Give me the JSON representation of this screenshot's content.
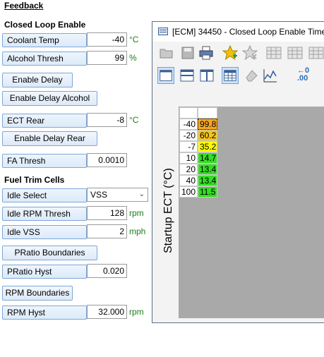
{
  "feedback_title": "Feedback",
  "closed_loop": {
    "heading": "Closed Loop Enable",
    "coolant_temp": {
      "label": "Coolant Temp",
      "value": "-40",
      "unit": "°C"
    },
    "alcohol_thresh": {
      "label": "Alcohol Thresh",
      "value": "99",
      "unit": "%"
    },
    "enable_delay_button": "Enable Delay",
    "enable_delay_alcohol_button": "Enable Delay Alcohol",
    "ect_rear": {
      "label": "ECT Rear",
      "value": "-8",
      "unit": "°C"
    },
    "enable_delay_rear_button": "Enable Delay Rear",
    "fa_thresh": {
      "label": "FA Thresh",
      "value": "0.0010"
    }
  },
  "fuel_trim": {
    "heading": "Fuel Trim Cells",
    "idle_select": {
      "label": "Idle Select",
      "value": "VSS"
    },
    "idle_rpm_thresh": {
      "label": "Idle RPM Thresh",
      "value": "128",
      "unit": "rpm"
    },
    "idle_vss": {
      "label": "Idle VSS",
      "value": "2",
      "unit": "mph"
    },
    "pratio_boundaries_button": "PRatio Boundaries",
    "pratio_hyst": {
      "label": "PRatio Hyst",
      "value": "0.020"
    },
    "rpm_boundaries_button": "RPM Boundaries",
    "rpm_hyst": {
      "label": "RPM Hyst",
      "value": "32.000",
      "unit": "rpm"
    }
  },
  "window": {
    "title": "[ECM] 34450 - Closed Loop Enable Time",
    "y_axis_label": "Startup ECT (°C)",
    "toolbar_icons": [
      "open-folder-icon",
      "save-icon",
      "print-icon",
      "add-favorite-icon",
      "remove-favorite-icon",
      "table-icon",
      "table-icon",
      "table-icon",
      "table-icon",
      "layout-single-icon",
      "layout-horizontal-split-icon",
      "layout-vertical-split-icon",
      "table-view-icon",
      "eraser-icon",
      "graph-icon",
      "decimal-places-icon"
    ],
    "decimal_icon_text": [
      "←0",
      ".00"
    ],
    "table": {
      "rows": [
        {
          "header": "-40",
          "value": "99.8",
          "color": "#f5a623",
          "selected": true
        },
        {
          "header": "-20",
          "value": "60.2",
          "color": "#f5c518"
        },
        {
          "header": "-7",
          "value": "35.2",
          "color": "#ffff00"
        },
        {
          "header": "10",
          "value": "14.7",
          "color": "#33dd22"
        },
        {
          "header": "20",
          "value": "13.4",
          "color": "#33dd22"
        },
        {
          "header": "40",
          "value": "13.4",
          "color": "#33dd22"
        },
        {
          "header": "100",
          "value": "11.5",
          "color": "#33dd22"
        }
      ]
    }
  }
}
